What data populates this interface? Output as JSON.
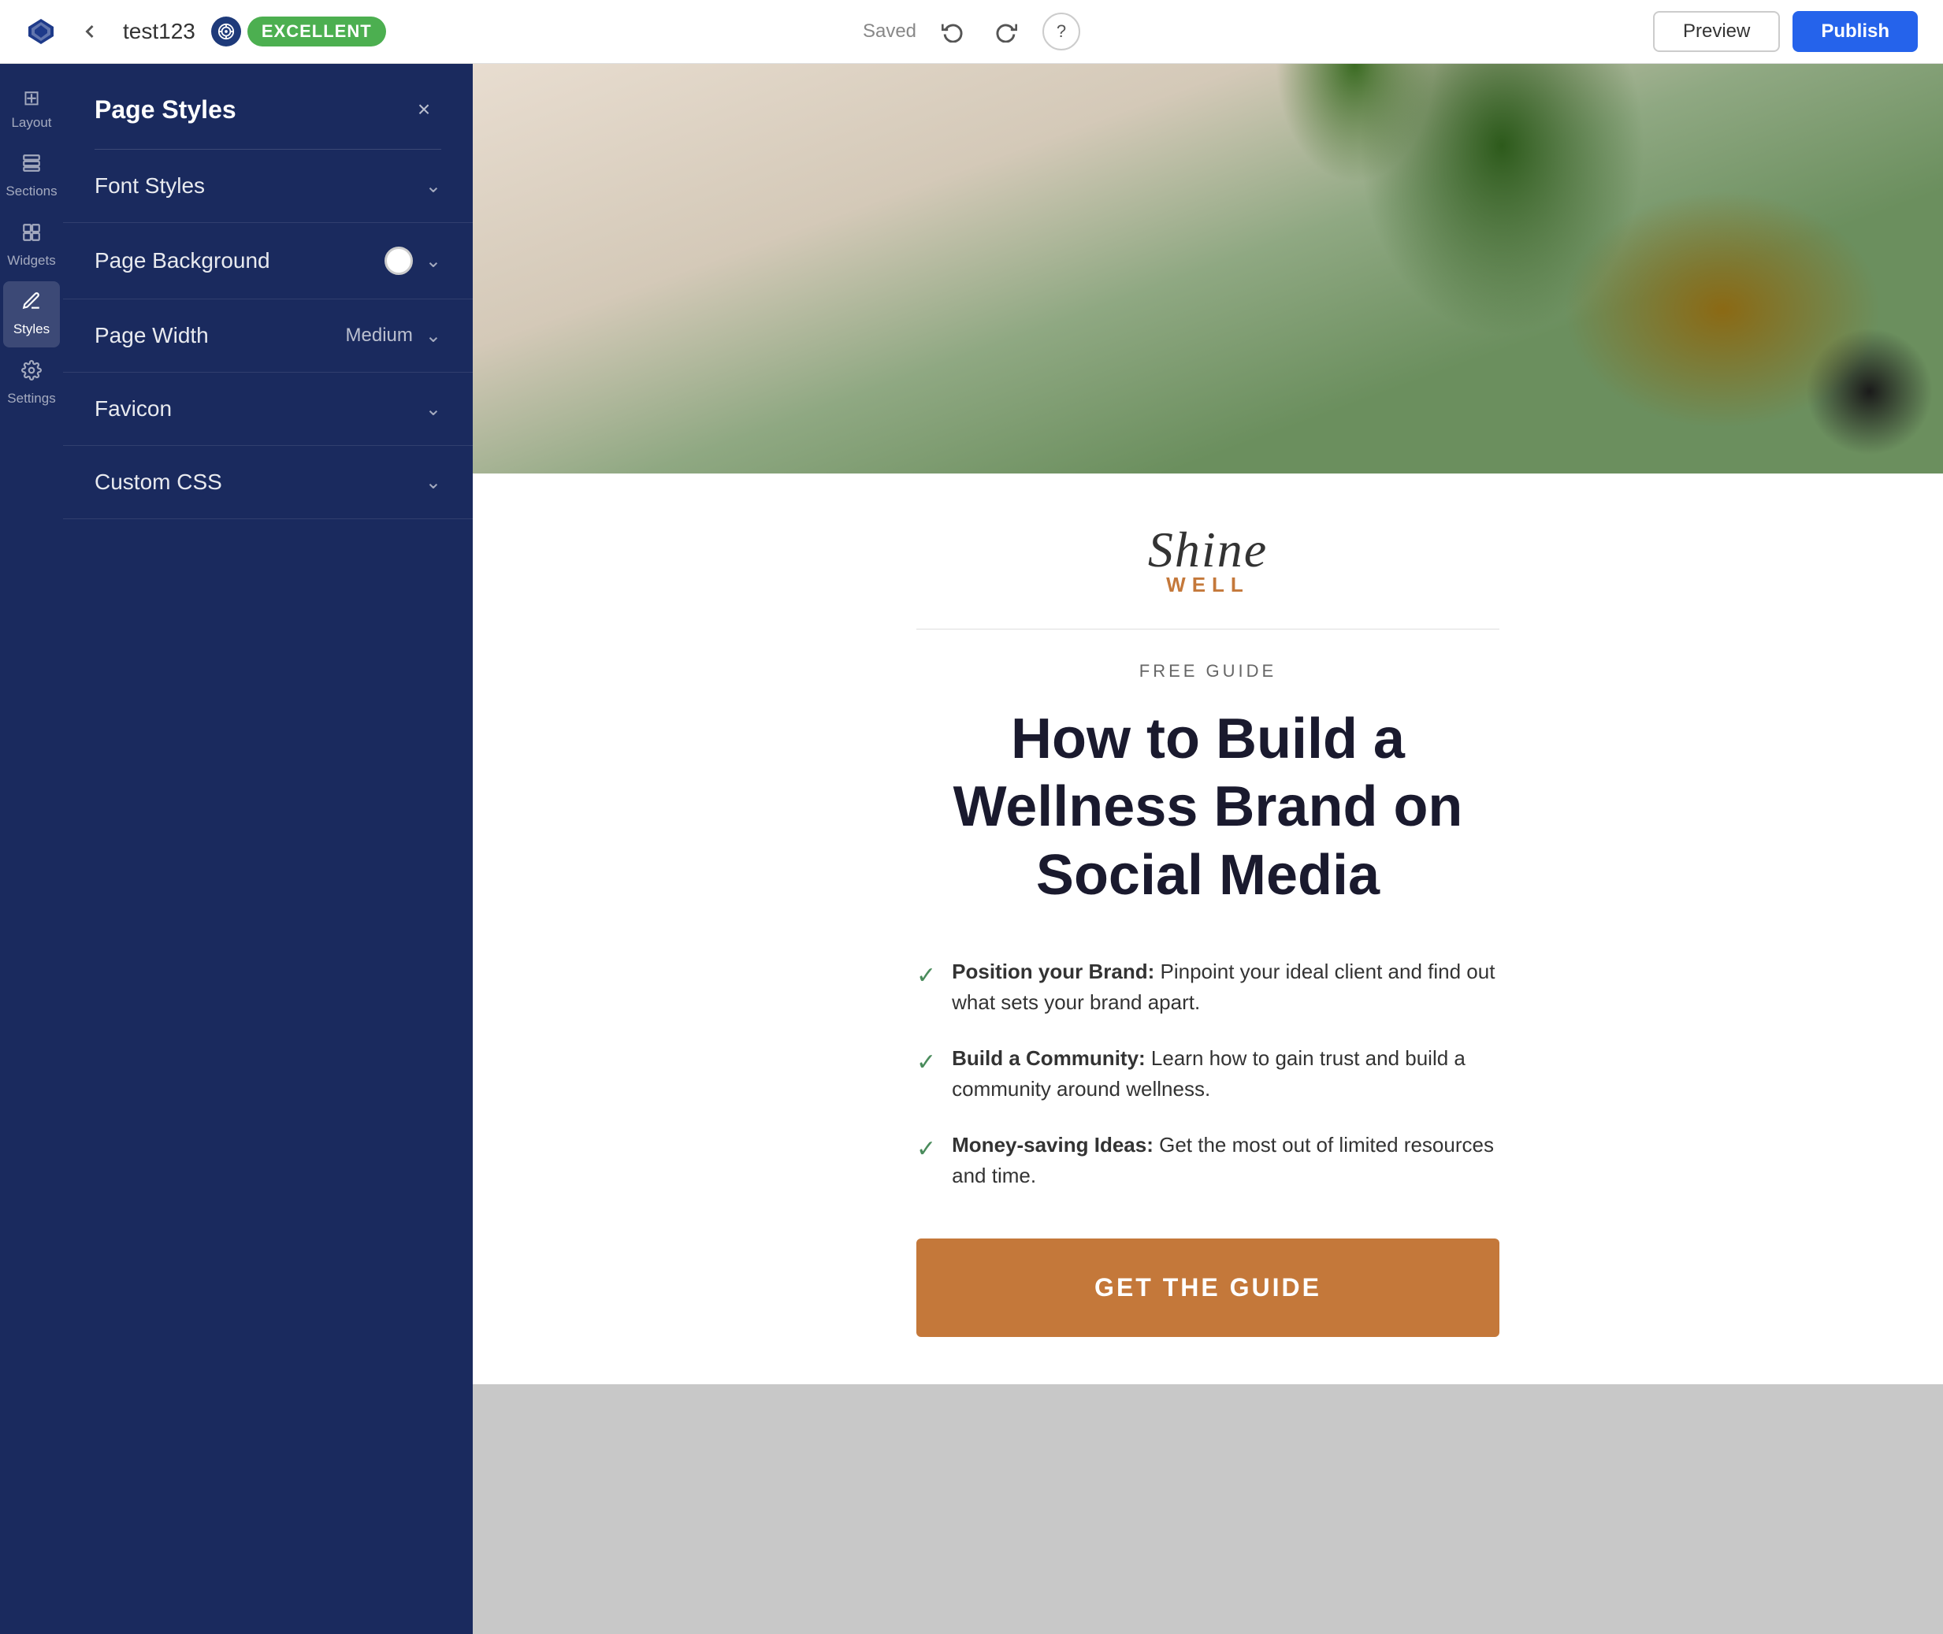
{
  "header": {
    "page_name": "test123",
    "quality_label": "EXCELLENT",
    "saved_label": "Saved",
    "help_label": "?",
    "preview_label": "Preview",
    "publish_label": "Publish"
  },
  "sidebar": {
    "items": [
      {
        "id": "layout",
        "label": "Layout",
        "icon": "⊞"
      },
      {
        "id": "sections",
        "label": "Sections",
        "icon": "☰"
      },
      {
        "id": "widgets",
        "label": "Widgets",
        "icon": "⊡"
      },
      {
        "id": "styles",
        "label": "Styles",
        "icon": "✏",
        "active": true
      },
      {
        "id": "settings",
        "label": "Settings",
        "icon": "⚙"
      }
    ]
  },
  "styles_panel": {
    "title": "Page Styles",
    "close_label": "×",
    "rows": [
      {
        "id": "font-styles",
        "label": "Font Styles",
        "has_chevron": true
      },
      {
        "id": "page-background",
        "label": "Page Background",
        "has_toggle": true,
        "has_chevron": true
      },
      {
        "id": "page-width",
        "label": "Page Width",
        "value": "Medium",
        "has_chevron": true
      },
      {
        "id": "favicon",
        "label": "Favicon",
        "has_chevron": true
      },
      {
        "id": "custom-css",
        "label": "Custom CSS",
        "has_chevron": true
      }
    ]
  },
  "landing_page": {
    "brand_script": "Shine",
    "brand_sub": "WELL",
    "free_guide": "FREE GUIDE",
    "headline": "How to Build a Wellness Brand on Social Media",
    "features": [
      {
        "bold": "Position your Brand:",
        "text": " Pinpoint your ideal client and find out what sets your brand apart."
      },
      {
        "bold": "Build a Community:",
        "text": " Learn how to gain trust and build a community around wellness."
      },
      {
        "bold": "Money-saving Ideas:",
        "text": " Get the most out of limited resources and time."
      }
    ],
    "cta_label": "GET THE GUIDE"
  },
  "colors": {
    "sidebar_bg": "#1a2a5e",
    "brand_accent": "#c4783a",
    "check_green": "#4a8c5c",
    "headline_dark": "#1a1a2e",
    "cta_bg": "#c4783a",
    "excellent_green": "#4caf50",
    "publish_blue": "#2563eb"
  }
}
